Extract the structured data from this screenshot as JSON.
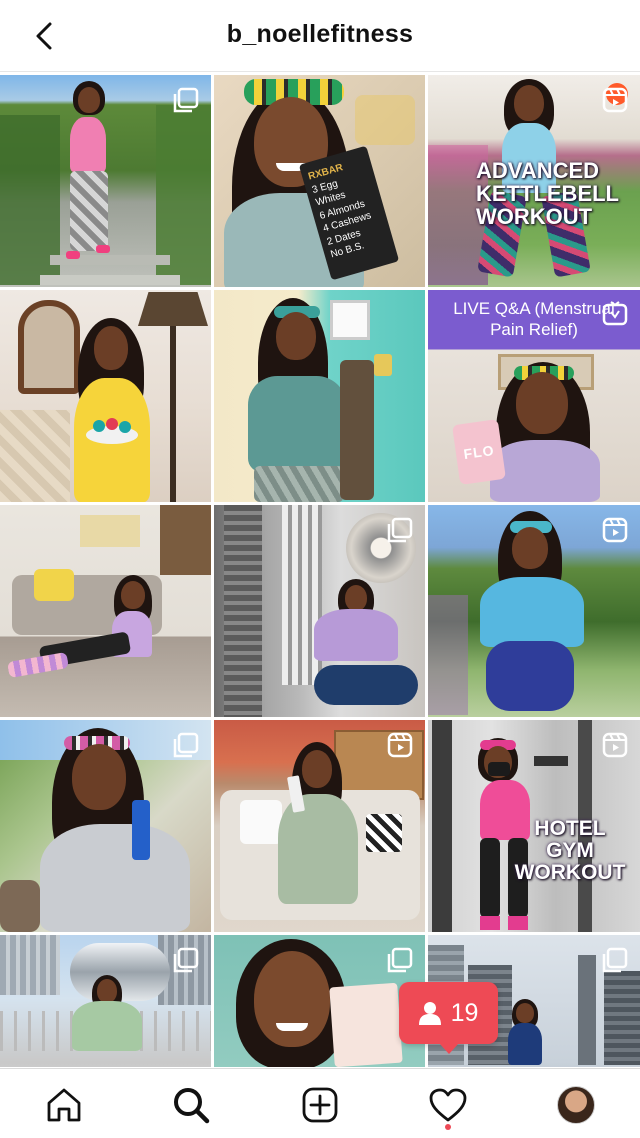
{
  "header": {
    "username": "b_noellefitness"
  },
  "tiles": [
    {
      "type": "carousel",
      "overlay": ""
    },
    {
      "type": "none",
      "overlay": "",
      "product_lines": [
        "RXBAR",
        "3 Egg Whites",
        "6 Almonds",
        "4 Cashews",
        "2 Dates",
        "No B.S."
      ]
    },
    {
      "type": "reel",
      "overlay": "ADVANCED KETTLEBELL WORKOUT"
    },
    {
      "type": "none",
      "overlay": ""
    },
    {
      "type": "none",
      "overlay": ""
    },
    {
      "type": "reel",
      "overlay": "LIVE Q&A (Menstrual Pain Relief)",
      "product_label": "FLO"
    },
    {
      "type": "none",
      "overlay": ""
    },
    {
      "type": "carousel",
      "overlay": ""
    },
    {
      "type": "reel",
      "overlay": ""
    },
    {
      "type": "carousel",
      "overlay": ""
    },
    {
      "type": "reel",
      "overlay": ""
    },
    {
      "type": "reel",
      "overlay": "HOTEL GYM WORKOUT"
    },
    {
      "type": "carousel",
      "overlay": ""
    },
    {
      "type": "carousel",
      "overlay": ""
    },
    {
      "type": "carousel",
      "overlay": ""
    }
  ],
  "notification": {
    "count": "19",
    "icon": "person-icon"
  },
  "bottom_nav": [
    {
      "name": "home",
      "icon": "home-icon"
    },
    {
      "name": "search",
      "icon": "search-icon"
    },
    {
      "name": "new-post",
      "icon": "plus-square-icon"
    },
    {
      "name": "activity",
      "icon": "heart-icon"
    },
    {
      "name": "profile",
      "icon": "avatar"
    }
  ],
  "colors": {
    "notification": "#ee4a55",
    "activity_dot": "#ed4956"
  }
}
